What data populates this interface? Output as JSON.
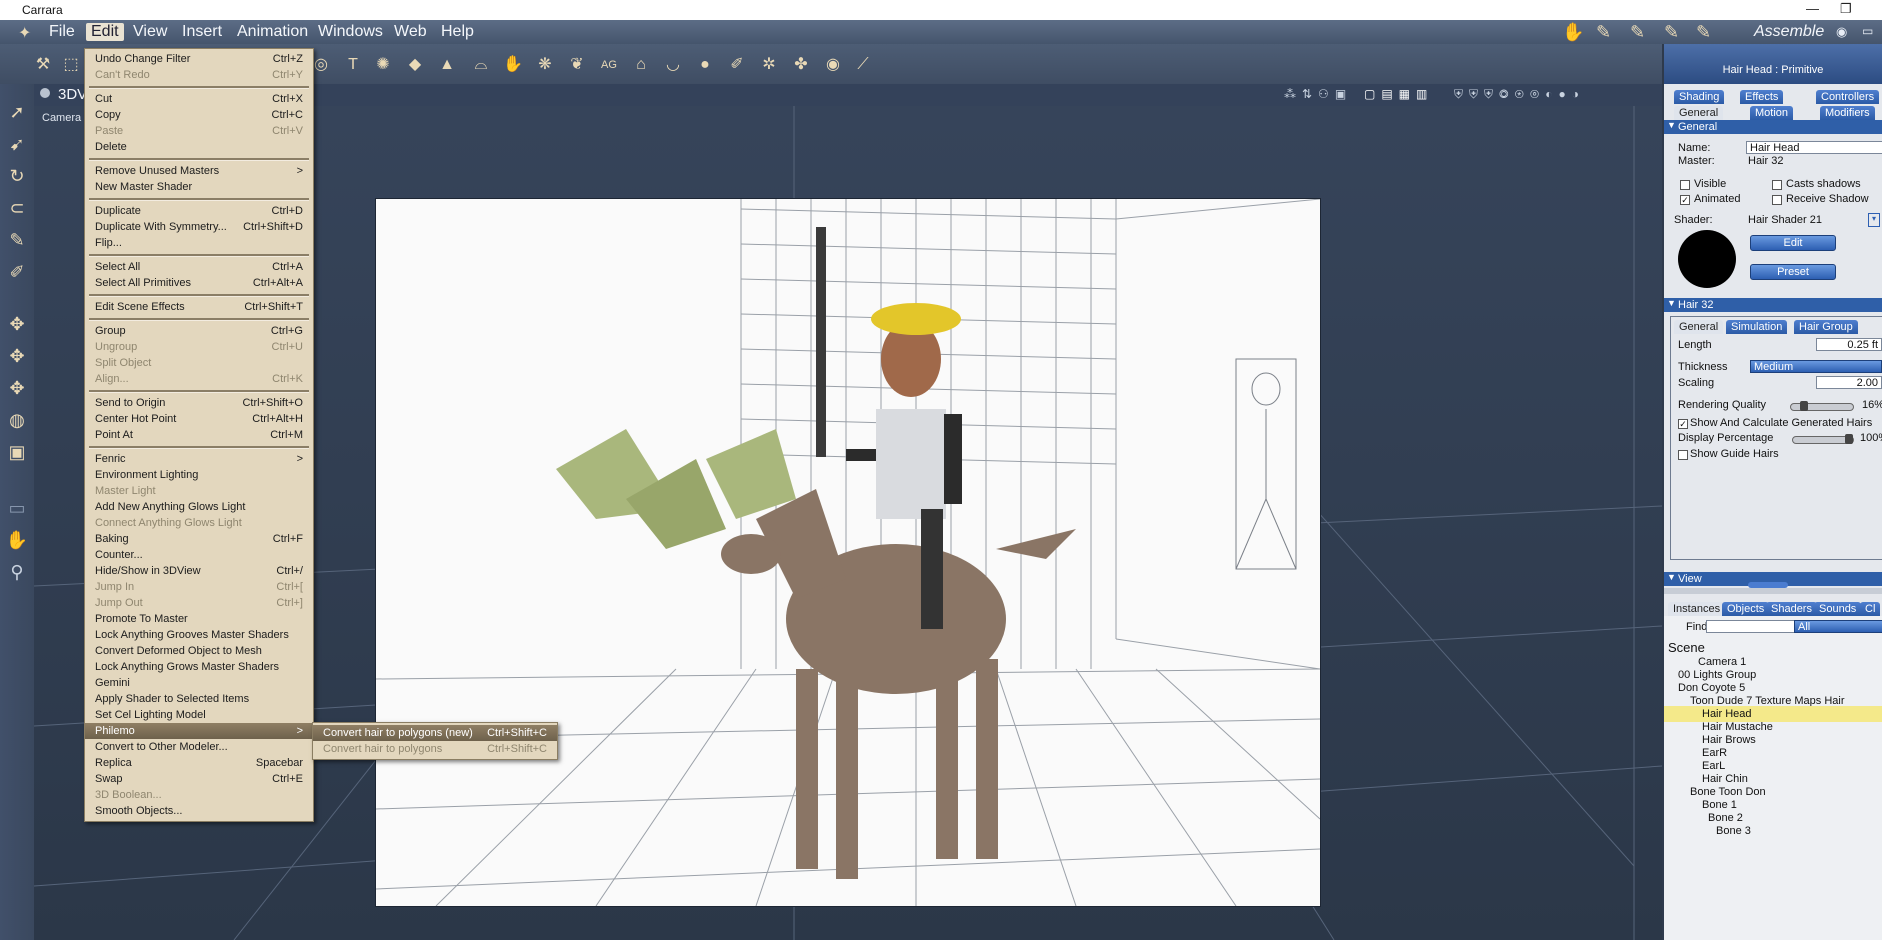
{
  "window": {
    "title": "Carrara",
    "minimize": "—",
    "restore": "❐"
  },
  "menubar": {
    "items": [
      "File",
      "Edit",
      "View",
      "Insert",
      "Animation",
      "Windows",
      "Web",
      "Help"
    ],
    "room": "Assemble"
  },
  "viewport": {
    "label": "3DV",
    "camera": "Camera"
  },
  "edit_menu": {
    "items": [
      {
        "label": "Undo Change Filter",
        "shortcut": "Ctrl+Z",
        "disabled": false
      },
      {
        "label": "Can't Redo",
        "shortcut": "Ctrl+Y",
        "disabled": true
      },
      {
        "label": "Cut",
        "shortcut": "Ctrl+X",
        "disabled": false
      },
      {
        "label": "Copy",
        "shortcut": "Ctrl+C",
        "disabled": false
      },
      {
        "label": "Paste",
        "shortcut": "Ctrl+V",
        "disabled": true
      },
      {
        "label": "Delete",
        "shortcut": "",
        "disabled": false
      },
      {
        "label": "Remove Unused Masters",
        "shortcut": ">",
        "disabled": false
      },
      {
        "label": "New Master Shader",
        "shortcut": "",
        "disabled": false
      },
      {
        "label": "Duplicate",
        "shortcut": "Ctrl+D",
        "disabled": false
      },
      {
        "label": "Duplicate With Symmetry...",
        "shortcut": "Ctrl+Shift+D",
        "disabled": false
      },
      {
        "label": "Flip...",
        "shortcut": "",
        "disabled": false
      },
      {
        "label": "Select All",
        "shortcut": "Ctrl+A",
        "disabled": false
      },
      {
        "label": "Select All Primitives",
        "shortcut": "Ctrl+Alt+A",
        "disabled": false
      },
      {
        "label": "Edit Scene Effects",
        "shortcut": "Ctrl+Shift+T",
        "disabled": false
      },
      {
        "label": "Group",
        "shortcut": "Ctrl+G",
        "disabled": false
      },
      {
        "label": "Ungroup",
        "shortcut": "Ctrl+U",
        "disabled": true
      },
      {
        "label": "Split Object",
        "shortcut": "",
        "disabled": true
      },
      {
        "label": "Align...",
        "shortcut": "Ctrl+K",
        "disabled": true
      },
      {
        "label": "Send to Origin",
        "shortcut": "Ctrl+Shift+O",
        "disabled": false
      },
      {
        "label": "Center Hot Point",
        "shortcut": "Ctrl+Alt+H",
        "disabled": false
      },
      {
        "label": "Point At",
        "shortcut": "Ctrl+M",
        "disabled": false
      },
      {
        "label": "Fenric",
        "shortcut": ">",
        "disabled": false
      },
      {
        "label": "Environment Lighting",
        "shortcut": "",
        "disabled": false
      },
      {
        "label": "Master Light",
        "shortcut": "",
        "disabled": true
      },
      {
        "label": "Add New Anything Glows Light",
        "shortcut": "",
        "disabled": false
      },
      {
        "label": "Connect Anything Glows Light",
        "shortcut": "",
        "disabled": true
      },
      {
        "label": "Baking",
        "shortcut": "Ctrl+F",
        "disabled": false
      },
      {
        "label": "Counter...",
        "shortcut": "",
        "disabled": false
      },
      {
        "label": "Hide/Show in 3DView",
        "shortcut": "Ctrl+/",
        "disabled": false
      },
      {
        "label": "Jump In",
        "shortcut": "Ctrl+[",
        "disabled": true
      },
      {
        "label": "Jump Out",
        "shortcut": "Ctrl+]",
        "disabled": true
      },
      {
        "label": "Promote To Master",
        "shortcut": "",
        "disabled": false
      },
      {
        "label": "Lock Anything Grooves Master Shaders",
        "shortcut": "",
        "disabled": false
      },
      {
        "label": "Convert Deformed Object to Mesh",
        "shortcut": "",
        "disabled": false
      },
      {
        "label": "Lock Anything Grows Master Shaders",
        "shortcut": "",
        "disabled": false
      },
      {
        "label": "Gemini",
        "shortcut": "",
        "disabled": false
      },
      {
        "label": "Apply Shader to Selected Items",
        "shortcut": "",
        "disabled": false
      },
      {
        "label": "Set Cel Lighting Model",
        "shortcut": "",
        "disabled": false
      },
      {
        "label": "Philemo",
        "shortcut": ">",
        "disabled": false
      },
      {
        "label": "Convert to Other Modeler...",
        "shortcut": "",
        "disabled": false
      },
      {
        "label": "Replica",
        "shortcut": "Spacebar",
        "disabled": false
      },
      {
        "label": "Swap",
        "shortcut": "Ctrl+E",
        "disabled": false
      },
      {
        "label": "3D Boolean...",
        "shortcut": "",
        "disabled": true
      },
      {
        "label": "Smooth Objects...",
        "shortcut": "",
        "disabled": false
      }
    ],
    "submenu": [
      {
        "label": "Convert hair to polygons (new)",
        "shortcut": "Ctrl+Shift+C",
        "disabled": false
      },
      {
        "label": "Convert hair to polygons",
        "shortcut": "Ctrl+Shift+C",
        "disabled": true
      }
    ]
  },
  "panel": {
    "title": "Hair Head : Primitive",
    "tabs_row1": [
      "Shading",
      "Effects",
      "Controllers"
    ],
    "tabs_row2": [
      "General",
      "Motion",
      "Modifiers"
    ],
    "section_general": "General",
    "name_label": "Name:",
    "name_value": "Hair Head",
    "master_label": "Master:",
    "master_value": "Hair 32",
    "visible": "Visible",
    "casts_shadows": "Casts shadows",
    "animated": "Animated",
    "receive_shadow": "Receive Shadow",
    "shader_label": "Shader:",
    "shader_value": "Hair Shader 21",
    "edit_btn": "Edit",
    "preset_btn": "Preset",
    "section_hair": "Hair 32",
    "hair_tabs": [
      "General",
      "Simulation",
      "Hair Group"
    ],
    "length_label": "Length",
    "length_value": "0.25 ft",
    "thickness_label": "Thickness",
    "thickness_value": "Medium",
    "scaling_label": "Scaling",
    "scaling_value": "2.00",
    "rq_label": "Rendering Quality",
    "rq_value": "16%",
    "rq_level": 0.16,
    "show_calc": "Show And Calculate Generated Hairs",
    "dp_label": "Display Percentage",
    "dp_value": "100%",
    "dp_level": 1.0,
    "show_guide": "Show Guide Hairs",
    "section_view": "View",
    "bottom_tabs": [
      "Instances",
      "Objects",
      "Shaders",
      "Sounds",
      "Cl"
    ],
    "find_label": "Find:",
    "find_value": "",
    "find_filter": "All",
    "scene_label": "Scene",
    "tree": [
      "Camera 1",
      "00 Lights Group",
      "Don Coyote 5",
      "Toon Dude 7 Texture Maps Hair",
      "Hair Head",
      "Hair Mustache",
      "Hair Brows",
      "EarR",
      "EarL",
      "Hair Chin",
      "Bone Toon Don",
      "Bone 1",
      "Bone 2",
      "Bone 3"
    ]
  }
}
